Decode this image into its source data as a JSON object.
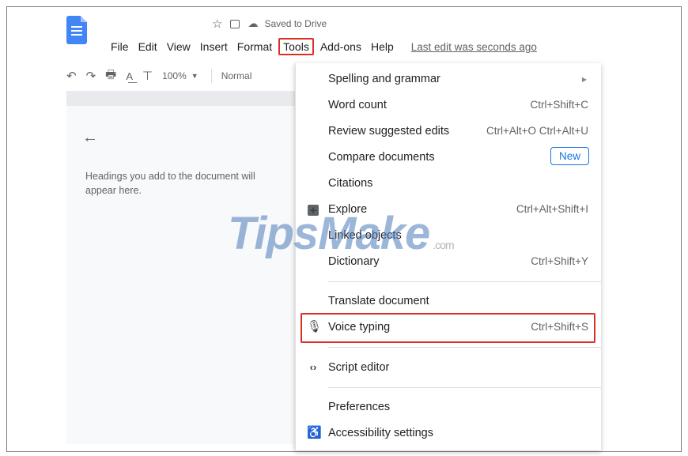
{
  "app": {
    "saved_status": "Saved to Drive",
    "icons": {
      "star": "star-icon",
      "move": "move-to-folder-icon",
      "cloud": "cloud-icon"
    }
  },
  "menubar": {
    "items": [
      {
        "label": "File"
      },
      {
        "label": "Edit"
      },
      {
        "label": "View"
      },
      {
        "label": "Insert"
      },
      {
        "label": "Format"
      },
      {
        "label": "Tools"
      },
      {
        "label": "Add-ons"
      },
      {
        "label": "Help"
      }
    ],
    "last_edit": "Last edit was seconds ago"
  },
  "toolbar": {
    "zoom": "100%",
    "style": "Normal"
  },
  "outline": {
    "hint": "Headings you add to the document will appear here."
  },
  "tools_menu": {
    "items": [
      {
        "label": "Spelling and grammar",
        "shortcut": ""
      },
      {
        "label": "Word count",
        "shortcut": "Ctrl+Shift+C"
      },
      {
        "label": "Review suggested edits",
        "shortcut": "Ctrl+Alt+O Ctrl+Alt+U"
      },
      {
        "label": "Compare documents",
        "badge": "New"
      },
      {
        "label": "Citations",
        "shortcut": ""
      },
      {
        "label": "Explore",
        "shortcut": "Ctrl+Alt+Shift+I"
      },
      {
        "label": "Linked objects",
        "shortcut": ""
      },
      {
        "label": "Dictionary",
        "shortcut": "Ctrl+Shift+Y"
      },
      {
        "label": "Translate document",
        "shortcut": ""
      },
      {
        "label": "Voice typing",
        "shortcut": "Ctrl+Shift+S"
      },
      {
        "label": "Script editor",
        "shortcut": ""
      },
      {
        "label": "Preferences",
        "shortcut": ""
      },
      {
        "label": "Accessibility settings",
        "shortcut": ""
      }
    ]
  },
  "watermark": {
    "text": "TipsMake",
    "suffix": ".com"
  },
  "colors": {
    "highlight": "#d93025",
    "badge": "#1a73e8",
    "docs_blue": "#4285f4"
  }
}
